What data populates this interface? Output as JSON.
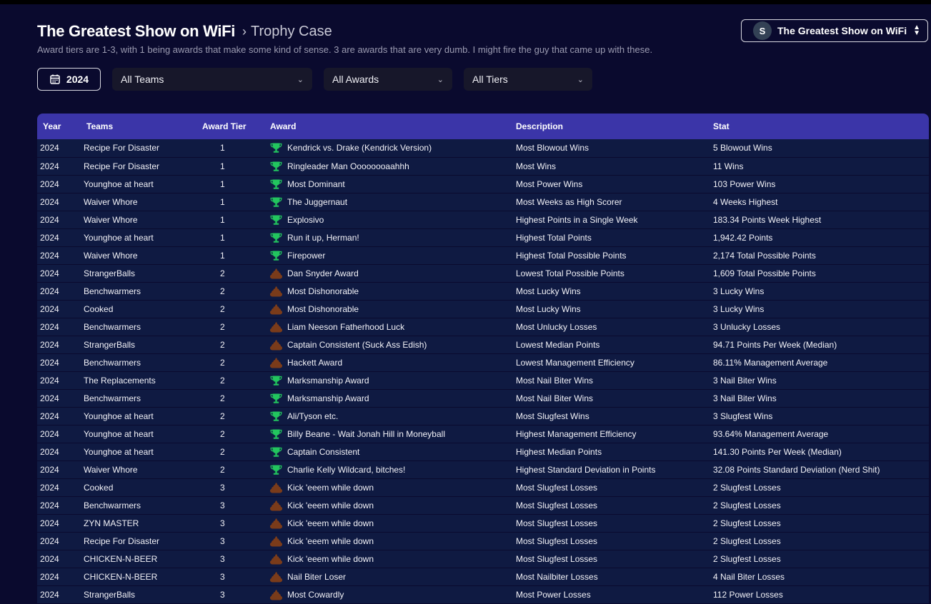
{
  "header": {
    "title": "The Greatest Show on WiFi",
    "crumb": "Trophy Case",
    "subtitle": "Award tiers are 1-3, with 1 being awards that make some kind of sense. 3 are awards that are very dumb. I might fire the guy that came up with these."
  },
  "team_switcher": {
    "avatar_letter": "S",
    "name": "The Greatest Show on WiFi"
  },
  "filters": {
    "year": "2024",
    "teams": "All Teams",
    "awards": "All Awards",
    "tiers": "All Tiers"
  },
  "colors": {
    "trophy": "#22c55e",
    "poop": "#7a3b1a",
    "header": "#3b35a8"
  },
  "table": {
    "headers": {
      "year": "Year",
      "teams": "Teams",
      "tier": "Award Tier",
      "award": "Award",
      "description": "Description",
      "stat": "Stat"
    },
    "rows": [
      {
        "year": "2024",
        "team": "Recipe For Disaster",
        "tier": "1",
        "icon": "trophy-icon",
        "award": "Kendrick vs. Drake (Kendrick Version)",
        "desc": "Most Blowout Wins",
        "stat": "5 Blowout Wins"
      },
      {
        "year": "2024",
        "team": "Recipe For Disaster",
        "tier": "1",
        "icon": "trophy-icon",
        "award": "Ringleader Man Oooooooaahhh",
        "desc": "Most Wins",
        "stat": "11 Wins"
      },
      {
        "year": "2024",
        "team": "Younghoe at heart",
        "tier": "1",
        "icon": "trophy-icon",
        "award": "Most Dominant",
        "desc": "Most Power Wins",
        "stat": "103 Power Wins"
      },
      {
        "year": "2024",
        "team": "Waiver Whore",
        "tier": "1",
        "icon": "trophy-icon",
        "award": "The Juggernaut",
        "desc": "Most Weeks as High Scorer",
        "stat": "4 Weeks Highest"
      },
      {
        "year": "2024",
        "team": "Waiver Whore",
        "tier": "1",
        "icon": "trophy-icon",
        "award": "Explosivo",
        "desc": "Highest Points in a Single Week",
        "stat": "183.34 Points Week Highest"
      },
      {
        "year": "2024",
        "team": "Younghoe at heart",
        "tier": "1",
        "icon": "trophy-icon",
        "award": "Run it up, Herman!",
        "desc": "Highest Total Points",
        "stat": "1,942.42 Points"
      },
      {
        "year": "2024",
        "team": "Waiver Whore",
        "tier": "1",
        "icon": "trophy-icon",
        "award": "Firepower",
        "desc": "Highest Total Possible Points",
        "stat": "2,174 Total Possible Points"
      },
      {
        "year": "2024",
        "team": "StrangerBalls",
        "tier": "2",
        "icon": "poop-icon",
        "award": "Dan Snyder Award",
        "desc": "Lowest Total Possible Points",
        "stat": "1,609 Total Possible Points"
      },
      {
        "year": "2024",
        "team": "Benchwarmers",
        "tier": "2",
        "icon": "poop-icon",
        "award": "Most Dishonorable",
        "desc": "Most Lucky Wins",
        "stat": "3 Lucky Wins"
      },
      {
        "year": "2024",
        "team": "Cooked",
        "tier": "2",
        "icon": "poop-icon",
        "award": "Most Dishonorable",
        "desc": "Most Lucky Wins",
        "stat": "3 Lucky Wins"
      },
      {
        "year": "2024",
        "team": "Benchwarmers",
        "tier": "2",
        "icon": "poop-icon",
        "award": "Liam Neeson Fatherhood Luck",
        "desc": "Most Unlucky Losses",
        "stat": "3 Unlucky Losses"
      },
      {
        "year": "2024",
        "team": "StrangerBalls",
        "tier": "2",
        "icon": "poop-icon",
        "award": "Captain Consistent (Suck Ass Edish)",
        "desc": "Lowest Median Points",
        "stat": "94.71 Points Per Week (Median)"
      },
      {
        "year": "2024",
        "team": "Benchwarmers",
        "tier": "2",
        "icon": "poop-icon",
        "award": "Hackett Award",
        "desc": "Lowest Management Efficiency",
        "stat": "86.11% Management Average"
      },
      {
        "year": "2024",
        "team": "The Replacements",
        "tier": "2",
        "icon": "trophy-icon",
        "award": "Marksmanship Award",
        "desc": "Most Nail Biter Wins",
        "stat": "3 Nail Biter Wins"
      },
      {
        "year": "2024",
        "team": "Benchwarmers",
        "tier": "2",
        "icon": "trophy-icon",
        "award": "Marksmanship Award",
        "desc": "Most Nail Biter Wins",
        "stat": "3 Nail Biter Wins"
      },
      {
        "year": "2024",
        "team": "Younghoe at heart",
        "tier": "2",
        "icon": "trophy-icon",
        "award": "Ali/Tyson etc.",
        "desc": "Most Slugfest Wins",
        "stat": "3 Slugfest Wins"
      },
      {
        "year": "2024",
        "team": "Younghoe at heart",
        "tier": "2",
        "icon": "trophy-icon",
        "award": "Billy Beane - Wait Jonah Hill in Moneyball",
        "desc": "Highest Management Efficiency",
        "stat": "93.64% Management Average"
      },
      {
        "year": "2024",
        "team": "Younghoe at heart",
        "tier": "2",
        "icon": "trophy-icon",
        "award": "Captain Consistent",
        "desc": "Highest Median Points",
        "stat": "141.30 Points Per Week (Median)"
      },
      {
        "year": "2024",
        "team": "Waiver Whore",
        "tier": "2",
        "icon": "trophy-icon",
        "award": "Charlie Kelly Wildcard, bitches!",
        "desc": "Highest Standard Deviation in Points",
        "stat": "32.08 Points Standard Deviation (Nerd Shit)"
      },
      {
        "year": "2024",
        "team": "Cooked",
        "tier": "3",
        "icon": "poop-icon",
        "award": "Kick 'eeem while down",
        "desc": "Most Slugfest Losses",
        "stat": "2 Slugfest Losses"
      },
      {
        "year": "2024",
        "team": "Benchwarmers",
        "tier": "3",
        "icon": "poop-icon",
        "award": "Kick 'eeem while down",
        "desc": "Most Slugfest Losses",
        "stat": "2 Slugfest Losses"
      },
      {
        "year": "2024",
        "team": "ZYN MASTER",
        "tier": "3",
        "icon": "poop-icon",
        "award": "Kick 'eeem while down",
        "desc": "Most Slugfest Losses",
        "stat": "2 Slugfest Losses"
      },
      {
        "year": "2024",
        "team": "Recipe For Disaster",
        "tier": "3",
        "icon": "poop-icon",
        "award": "Kick 'eeem while down",
        "desc": "Most Slugfest Losses",
        "stat": "2 Slugfest Losses"
      },
      {
        "year": "2024",
        "team": "CHICKEN-N-BEER",
        "tier": "3",
        "icon": "poop-icon",
        "award": "Kick 'eeem while down",
        "desc": "Most Slugfest Losses",
        "stat": "2 Slugfest Losses"
      },
      {
        "year": "2024",
        "team": "CHICKEN-N-BEER",
        "tier": "3",
        "icon": "poop-icon",
        "award": "Nail Biter Loser",
        "desc": "Most Nailbiter Losses",
        "stat": "4 Nail Biter Losses"
      },
      {
        "year": "2024",
        "team": "StrangerBalls",
        "tier": "3",
        "icon": "poop-icon",
        "award": "Most Cowardly",
        "desc": "Most Power Losses",
        "stat": "112 Power Losses"
      }
    ]
  }
}
